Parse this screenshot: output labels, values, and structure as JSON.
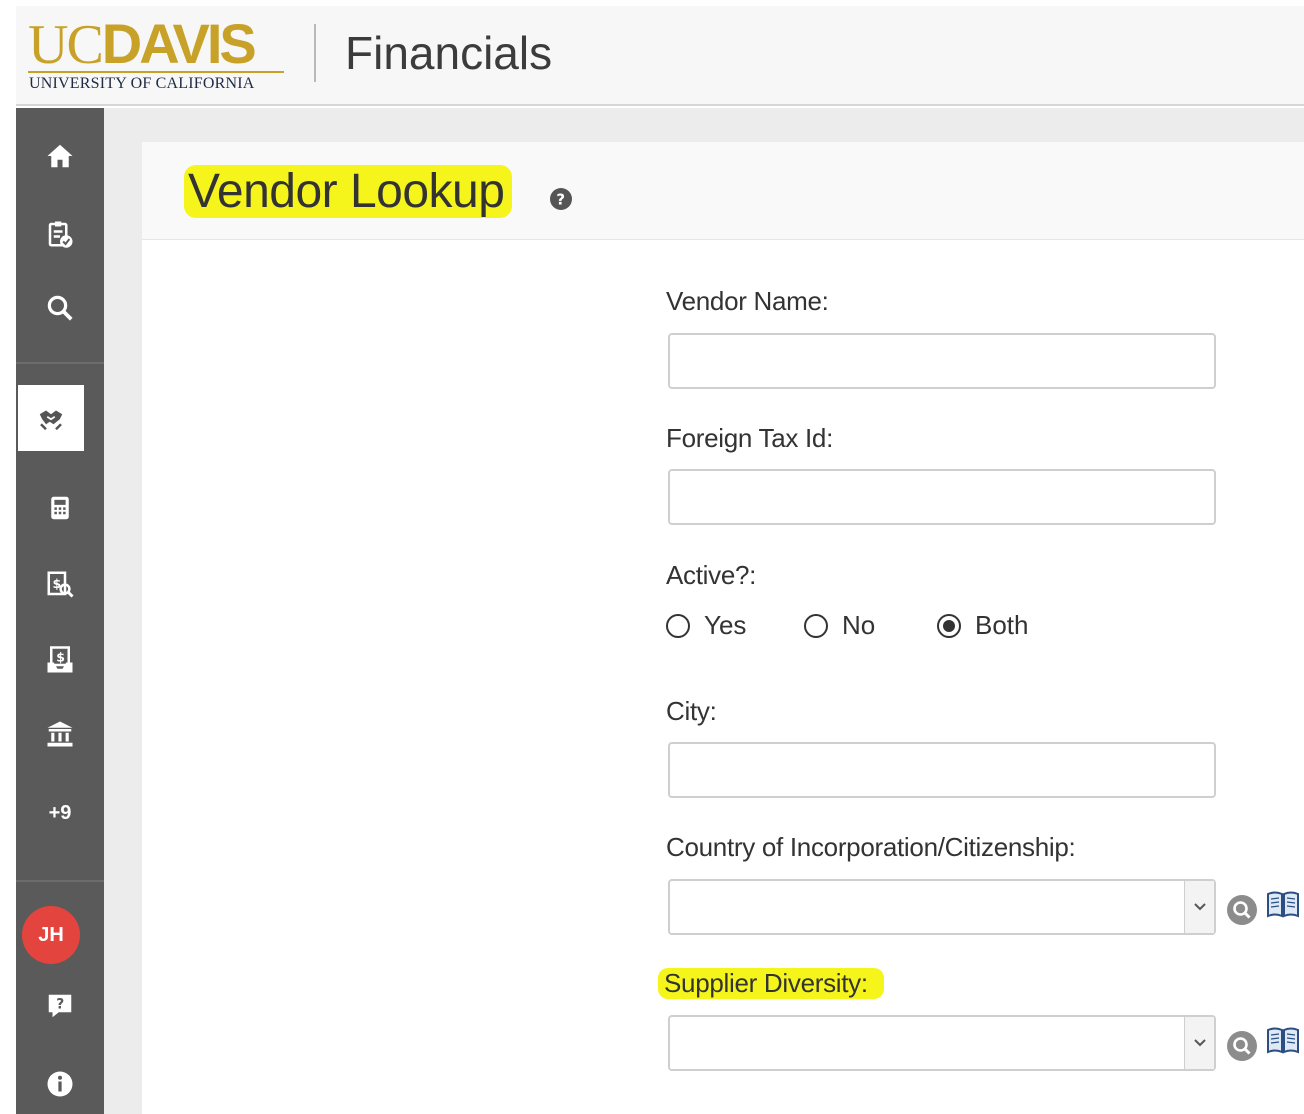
{
  "header": {
    "logo_text_light": "UC",
    "logo_text_bold": "DAVIS",
    "logo_subtext": "UNIVERSITY OF CALIFORNIA",
    "app_title": "Financials"
  },
  "sidebar": {
    "items": [
      {
        "icon": "home-icon"
      },
      {
        "icon": "clipboard-check-icon"
      },
      {
        "icon": "search-icon"
      },
      {
        "icon": "handshake-icon",
        "active": true
      },
      {
        "icon": "calculator-icon"
      },
      {
        "icon": "invoice-search-icon"
      },
      {
        "icon": "payment-icon"
      },
      {
        "icon": "bank-icon"
      }
    ],
    "more_label": "+9",
    "user_initials": "JH",
    "avatar_color": "#e4443e"
  },
  "page": {
    "title": "Vendor Lookup",
    "highlight_color": "#f5f51c"
  },
  "form": {
    "vendor_name_label": "Vendor Name:",
    "vendor_name_value": "",
    "foreign_tax_id_label": "Foreign Tax Id:",
    "foreign_tax_id_value": "",
    "active_label": "Active?:",
    "active_options": [
      "Yes",
      "No",
      "Both"
    ],
    "active_selected": "Both",
    "city_label": "City:",
    "city_value": "",
    "country_label": "Country of Incorporation/Citizenship:",
    "country_value": "",
    "supplier_diversity_label": "Supplier Diversity:",
    "supplier_diversity_value": ""
  },
  "colors": {
    "brand_gold": "#c8a228",
    "sidebar_bg": "#5a5a5a"
  }
}
